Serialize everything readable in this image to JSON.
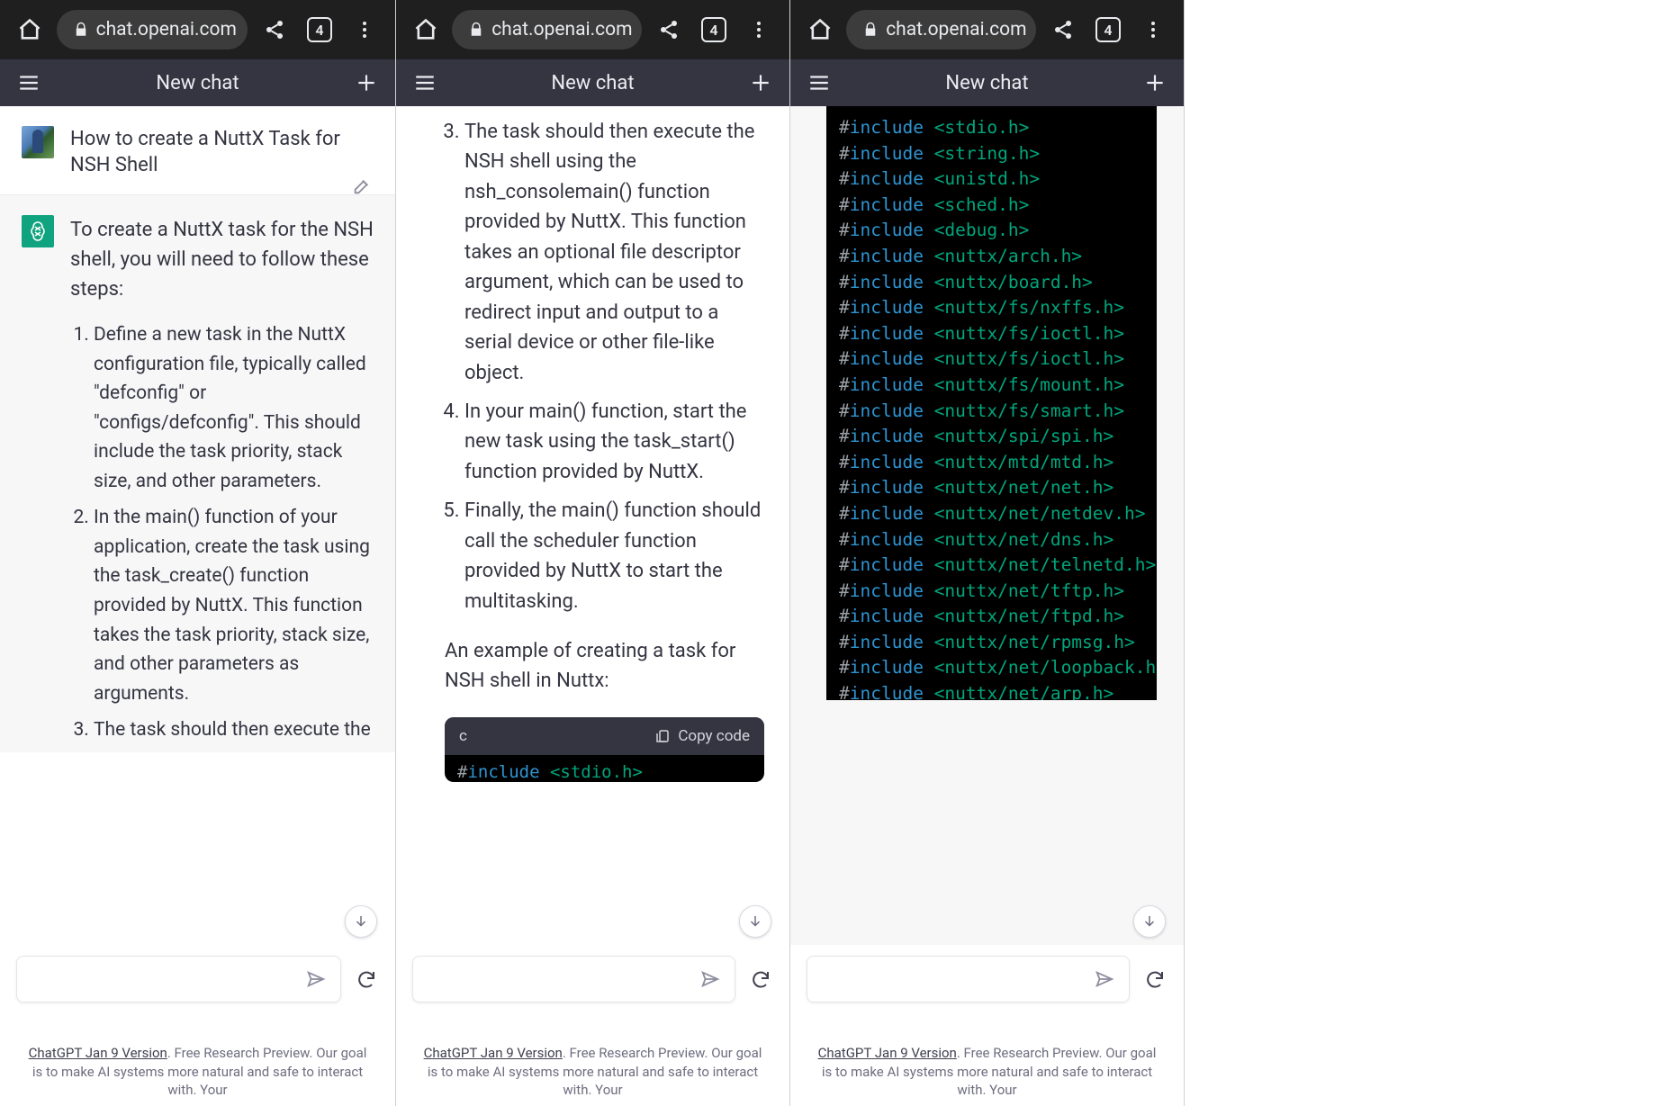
{
  "browser": {
    "url": "chat.openai.com",
    "tab_count": "4"
  },
  "app": {
    "title": "New chat"
  },
  "footer": {
    "version": "ChatGPT Jan 9 Version",
    "text": ". Free Research Preview. Our goal is to make AI systems more natural and safe to interact with. Your"
  },
  "screen1": {
    "user_message": "How to create a NuttX Task for NSH Shell",
    "ai_intro": "To create a NuttX task for the NSH shell, you will need to follow these steps:",
    "steps": [
      "Define a new task in the NuttX configuration file, typically called \"defconfig\" or \"configs/defconfig\". This should include the task priority, stack size, and other parameters.",
      "In the main() function of your application, create the task using the task_create() function provided by NuttX. This function takes the task priority, stack size, and other parameters as arguments.",
      "The task should then execute the"
    ]
  },
  "screen2": {
    "steps": [
      "The task should then execute the NSH shell using the nsh_consolemain() function provided by NuttX. This function takes an optional file descriptor argument, which can be used to redirect input and output to a serial device or other file-like object.",
      "In your main() function, start the new task using the task_start() function provided by NuttX.",
      "Finally, the main() function should call the scheduler function provided by NuttX to start the multitasking."
    ],
    "example_text": "An example of creating a task for NSH shell in Nuttx:",
    "code_lang": "c",
    "copy_label": "Copy code",
    "code_line_include": "<stdio.h>"
  },
  "screen3": {
    "includes": [
      "<stdio.h>",
      "<string.h>",
      "<unistd.h>",
      "<sched.h>",
      "<debug.h>",
      "<nuttx/arch.h>",
      "<nuttx/board.h>",
      "<nuttx/fs/nxffs.h>",
      "<nuttx/fs/ioctl.h>",
      "<nuttx/fs/ioctl.h>",
      "<nuttx/fs/mount.h>",
      "<nuttx/fs/smart.h>",
      "<nuttx/spi/spi.h>",
      "<nuttx/mtd/mtd.h>",
      "<nuttx/net/net.h>",
      "<nuttx/net/netdev.h>",
      "<nuttx/net/dns.h>",
      "<nuttx/net/telnetd.h>",
      "<nuttx/net/tftp.h>",
      "<nuttx/net/ftpd.h>",
      "<nuttx/net/rpmsg.h>",
      "<nuttx/net/loopback.h>",
      "<nuttx/net/arp.h>"
    ]
  }
}
